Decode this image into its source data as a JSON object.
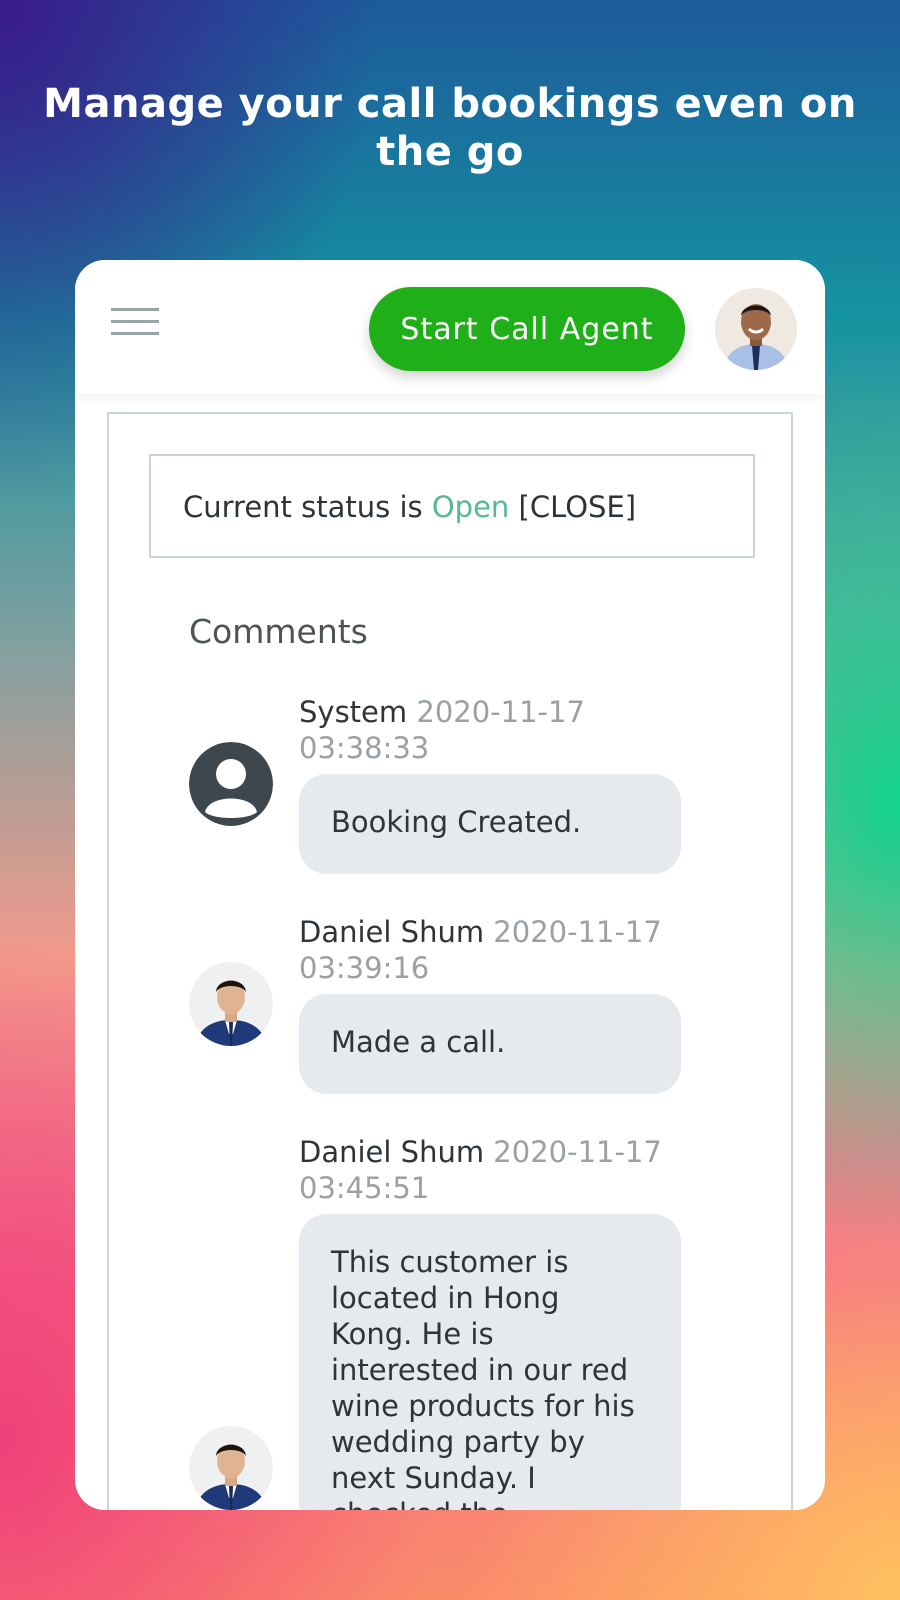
{
  "headline": "Manage your call bookings even on the go",
  "topbar": {
    "start_button_label": "Start Call Agent"
  },
  "status": {
    "prefix": "Current status is",
    "value": "Open",
    "action": "[CLOSE]"
  },
  "comments": {
    "title": "Comments",
    "items": [
      {
        "author": "System",
        "timestamp": "2020-11-17 03:38:33",
        "text": "Booking Created."
      },
      {
        "author": "Daniel Shum",
        "timestamp": "2020-11-17 03:39:16",
        "text": "Made a call."
      },
      {
        "author": "Daniel Shum",
        "timestamp": "2020-11-17 03:45:51",
        "text": "This customer is located in Hong Kong. He is interested in our red wine products for his wedding party by next Sunday. I checked the Singapore"
      }
    ]
  },
  "colors": {
    "button_green": "#1faf18",
    "status_open": "#57b894",
    "bubble_bg": "#e6e9ed"
  }
}
